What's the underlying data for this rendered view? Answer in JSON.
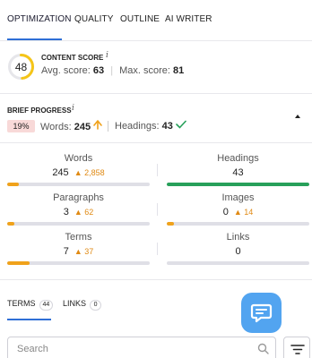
{
  "tabs": [
    {
      "label": "OPTIMIZATION",
      "active": true
    },
    {
      "label": "QUALITY",
      "active": false
    },
    {
      "label": "OUTLINE",
      "active": false
    },
    {
      "label": "AI WRITER",
      "active": false
    }
  ],
  "content_score": {
    "title": "CONTENT SCORE",
    "info": "i",
    "score": "48",
    "score_fraction": 0.48,
    "avg_label": "Avg. score:",
    "avg_value": "63",
    "max_label": "Max. score:",
    "max_value": "81"
  },
  "brief_progress": {
    "title": "BRIEF PROGRESS",
    "info": "i",
    "percent": "19%",
    "words_label": "Words:",
    "words_value": "245",
    "headings_label": "Headings:",
    "headings_value": "43"
  },
  "metrics": {
    "words": {
      "label": "Words",
      "value": "245",
      "delta": "2,858",
      "progress": 0.08,
      "color": "#f0a21b"
    },
    "headings": {
      "label": "Headings",
      "value": "43",
      "progress": 1.0,
      "color": "#27a05a"
    },
    "paragraphs": {
      "label": "Paragraphs",
      "value": "3",
      "delta": "62",
      "progress": 0.05,
      "color": "#f0a21b"
    },
    "images": {
      "label": "Images",
      "value": "0",
      "delta": "14",
      "progress": 0.05,
      "color": "#f0a21b"
    },
    "terms": {
      "label": "Terms",
      "value": "7",
      "delta": "37",
      "progress": 0.16,
      "color": "#f0a21b"
    },
    "links": {
      "label": "Links",
      "value": "0",
      "progress": 0.0,
      "color": "#f0a21b"
    }
  },
  "bottom_tabs": [
    {
      "label": "TERMS",
      "count": "44",
      "active": true
    },
    {
      "label": "LINKS",
      "count": "0",
      "active": false
    }
  ],
  "search": {
    "placeholder": "Search"
  },
  "colors": {
    "accent": "#2f6fd6",
    "orange": "#f0a21b",
    "green": "#27a05a",
    "chat": "#52a4f0"
  }
}
